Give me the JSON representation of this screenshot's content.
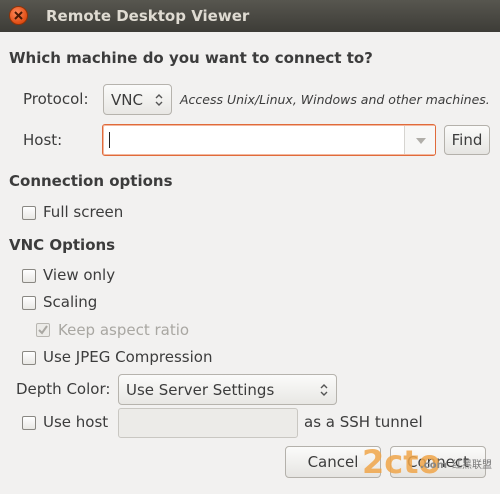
{
  "window": {
    "title": "Remote Desktop Viewer"
  },
  "prompt": "Which machine do you want to connect to?",
  "protocol": {
    "label": "Protocol:",
    "value": "VNC",
    "description": "Access Unix/Linux, Windows and other machines."
  },
  "host": {
    "label": "Host:",
    "value": "",
    "find_label": "Find"
  },
  "connection_options": {
    "heading": "Connection options",
    "full_screen": "Full screen"
  },
  "vnc_options": {
    "heading": "VNC Options",
    "view_only": "View only",
    "scaling": "Scaling",
    "keep_aspect": "Keep aspect ratio",
    "jpeg": "Use JPEG Compression",
    "depth_label": "Depth Color:",
    "depth_value": "Use Server Settings",
    "use_host": "Use host",
    "ssh_host_value": "",
    "ssh_suffix": "as a SSH tunnel"
  },
  "buttons": {
    "cancel": "Cancel",
    "connect": "Connect"
  },
  "watermark": {
    "brand": "2cto",
    "suffix": ".com",
    "cn": "红黑联盟"
  },
  "colors": {
    "accent": "#e06a3a",
    "titlebar": "#3d3c37"
  }
}
